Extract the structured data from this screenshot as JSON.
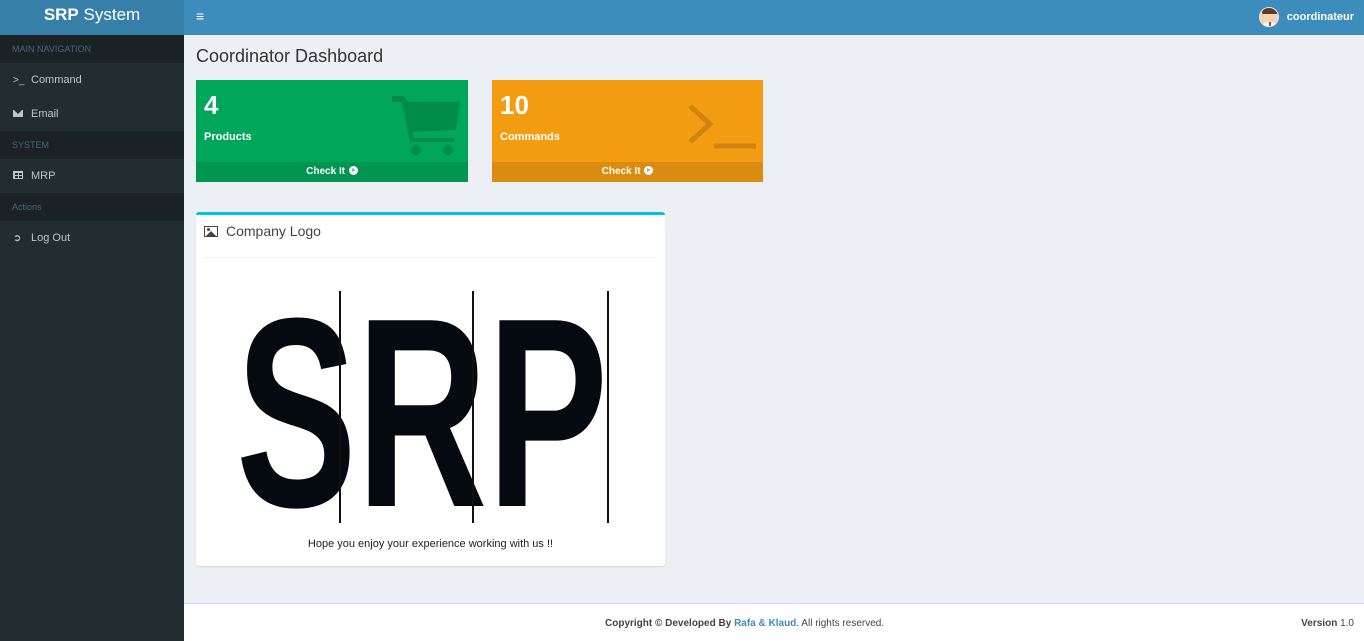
{
  "brand": {
    "bold": "SRP",
    "rest": " System"
  },
  "topbar": {
    "menu_icon": "hamburger-icon",
    "username": "coordinateur",
    "avatar_icon": "user-avatar"
  },
  "sidebar": {
    "sections": [
      {
        "header": "MAIN NAVIGATION",
        "items": [
          {
            "label": "Command",
            "icon": "terminal-icon"
          },
          {
            "label": "Email",
            "icon": "envelope-icon"
          }
        ]
      },
      {
        "header": "SYSTEM",
        "items": [
          {
            "label": "MRP",
            "icon": "table-icon"
          }
        ]
      },
      {
        "header": "Actions",
        "items": [
          {
            "label": "Log Out",
            "icon": "sign-out-icon"
          }
        ]
      }
    ]
  },
  "page": {
    "title": "Coordinator Dashboard"
  },
  "stats": [
    {
      "value": "4",
      "label": "Products",
      "link": "Check It",
      "icon": "shopping-cart-icon",
      "color": "#00a65a"
    },
    {
      "value": "10",
      "label": "Commands",
      "link": "Check It",
      "icon": "terminal-icon",
      "color": "#f39c12"
    }
  ],
  "logo_box": {
    "title": "Company Logo",
    "icon": "picture-icon",
    "logo_text": "SRP",
    "message": "Hope you enjoy your experience working with us !!",
    "accent": "#00c0ef"
  },
  "footer": {
    "prefix": "Copyright © Developed By ",
    "authors": "Rafa & Klaud",
    "suffix": ". All rights reserved.",
    "version_label": "Version",
    "version": " 1.0"
  }
}
